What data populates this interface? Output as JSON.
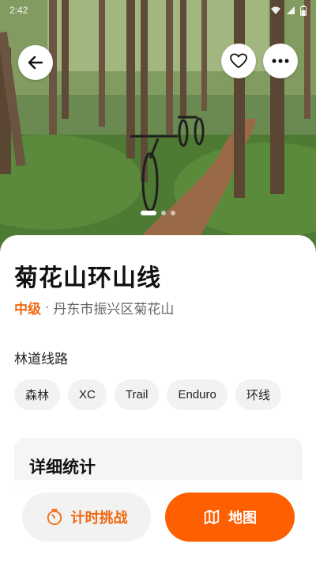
{
  "status_bar": {
    "time": "2:42"
  },
  "hero": {
    "carousel": {
      "total": 3,
      "active_index": 0
    }
  },
  "route": {
    "title": "菊花山环山线",
    "difficulty": "中级",
    "separator": "·",
    "location": "丹东市振兴区菊花山"
  },
  "section_label": "林道线路",
  "tags": [
    "森林",
    "XC",
    "Trail",
    "Enduro",
    "环线"
  ],
  "stats": {
    "title": "详细统计"
  },
  "actions": {
    "challenge_label": "计时挑战",
    "map_label": "地图"
  },
  "colors": {
    "accent": "#f06a12",
    "primary_button": "#fe5f00",
    "tag_bg": "#f2f2f2"
  },
  "icons": {
    "back": "arrow-left-icon",
    "favorite": "heart-outline-icon",
    "more": "more-horizontal-icon",
    "challenge": "stopwatch-icon",
    "map": "map-icon"
  }
}
